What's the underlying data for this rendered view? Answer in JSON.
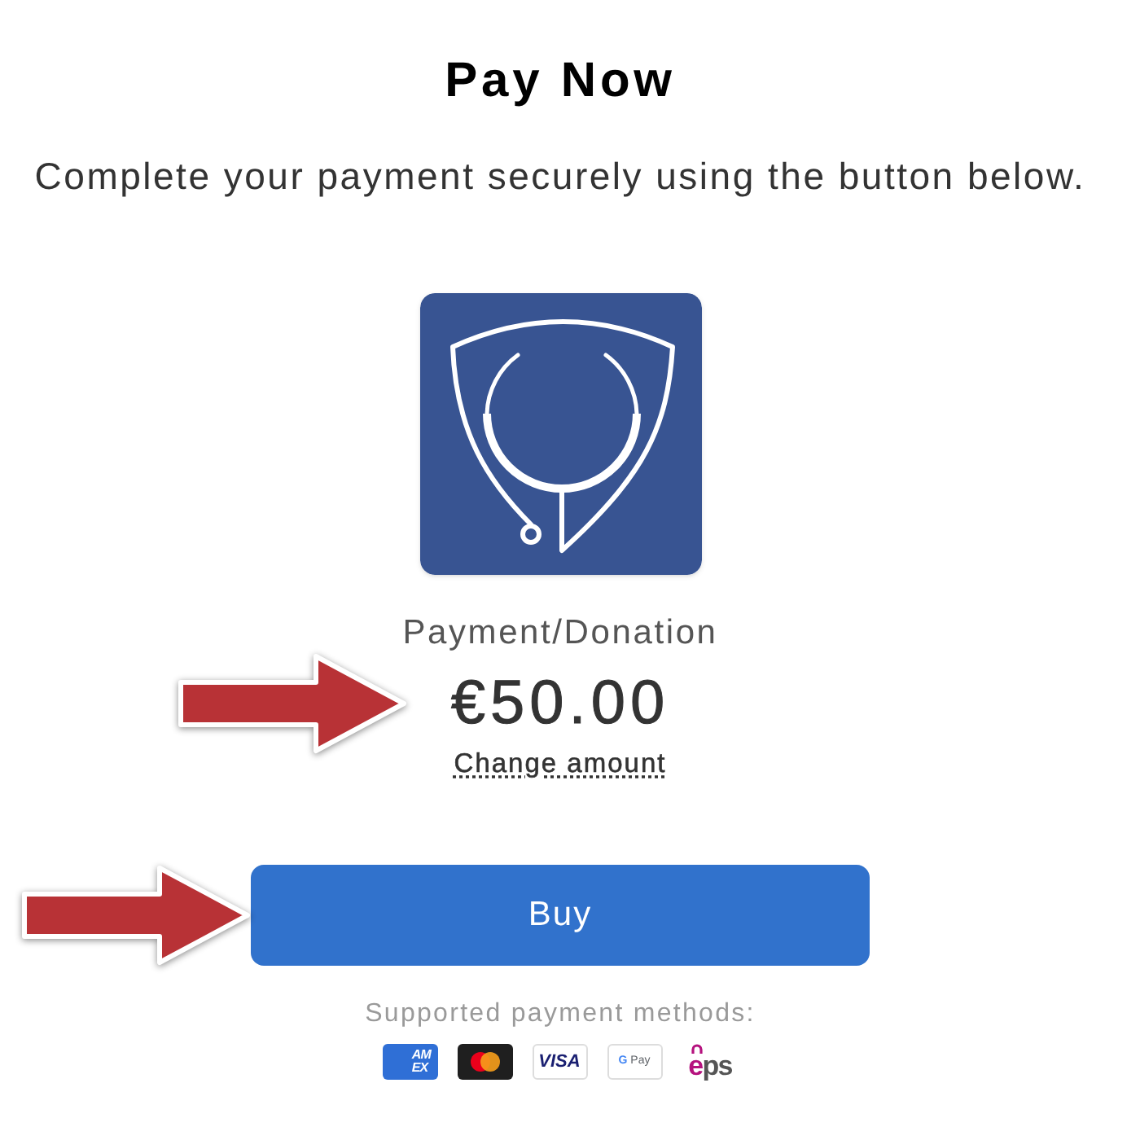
{
  "title": "Pay Now",
  "subtitle": "Complete your payment securely using the button below.",
  "product": {
    "name": "Payment/Donation",
    "price": "€50.00",
    "change_link": "Change amount",
    "arrow": true
  },
  "buy_button": {
    "label": "Buy",
    "arrow": true
  },
  "payment_methods": {
    "heading": "Supported payment methods:",
    "items": [
      {
        "kind": "amex",
        "lines": [
          "AM",
          "EX"
        ]
      },
      {
        "kind": "mastercard"
      },
      {
        "kind": "visa",
        "label": "VISA"
      },
      {
        "kind": "gpay",
        "mark": "G",
        "label": "Pay"
      },
      {
        "kind": "eps",
        "mark": "e",
        "label": "ps"
      }
    ]
  }
}
